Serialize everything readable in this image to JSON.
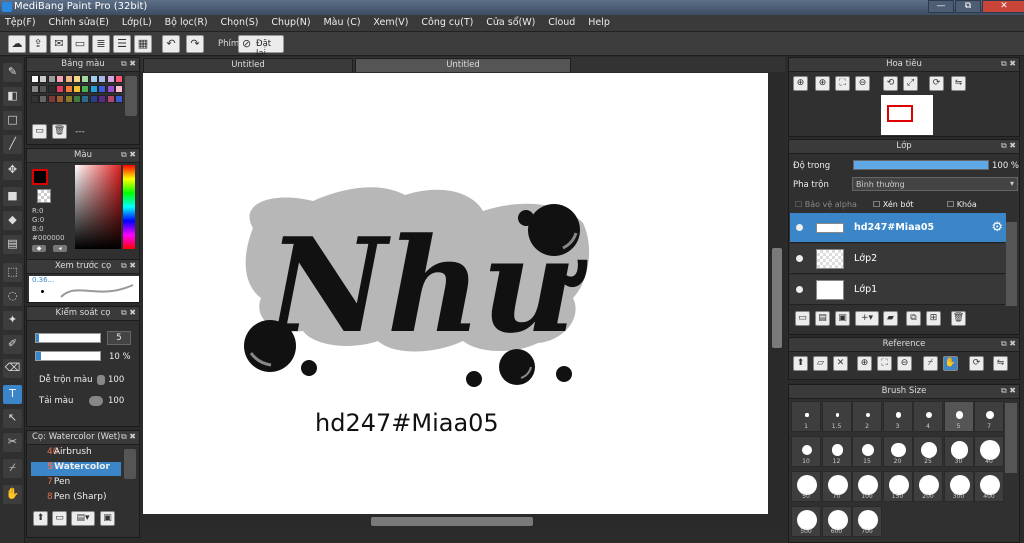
{
  "window": {
    "title": "MediBang Paint Pro (32bit)",
    "min": "—",
    "max": "⧉",
    "close": "✕"
  },
  "menu": [
    "Tệp(F)",
    "Chỉnh sửa(E)",
    "Lớp(L)",
    "Bộ lọc(R)",
    "Chọn(S)",
    "Chụp(N)",
    "Màu (C)",
    "Xem(V)",
    "Công cụ(T)",
    "Cửa sổ(W)",
    "Cloud",
    "Help"
  ],
  "toolbar": {
    "phim_label": "Phím",
    "reset_label": "Đặt lại"
  },
  "left_panels": {
    "palette": {
      "title": "Bảng màu",
      "dash": "---"
    },
    "color": {
      "title": "Màu",
      "r": "R:0",
      "g": "G:0",
      "b": "B:0",
      "hex": "#000000"
    },
    "brush_preview": {
      "title": "Xem trước cọ",
      "size": "0.36..."
    },
    "brush_control": {
      "title": "Kiểm soát cọ",
      "size_value": "5",
      "opacity_value": "10 %",
      "blend_label": "Dễ trộn màu",
      "blend_value": "100",
      "amount_label": "Tải màu",
      "amount_value": "100"
    },
    "brush_list": {
      "title": "Cọ: Watercolor (Wet)",
      "items": [
        {
          "num": "40",
          "name": "Airbrush"
        },
        {
          "num": "5",
          "name": "Watercolor"
        },
        {
          "num": "7",
          "name": "Pen"
        },
        {
          "num": "8",
          "name": "Pen (Sharp)"
        }
      ]
    }
  },
  "tabs": [
    "Untitled",
    "Untitled"
  ],
  "artwork": {
    "main_text": "Như",
    "caption": "hd247#Miaa05"
  },
  "right_panels": {
    "navigator": {
      "title": "Hoa tiêu"
    },
    "layer": {
      "title": "Lớp",
      "opacity_label": "Độ trong",
      "opacity_value": "100 %",
      "opacity_fraction": 1.0,
      "blend_label": "Pha trộn",
      "blend_value": "Bình thường",
      "alpha_label": "Bảo vệ alpha",
      "clip_label": "Xén bớt",
      "lock_label": "Khóa",
      "layers": [
        {
          "name": "hd247#Miaa05",
          "selected": true
        },
        {
          "name": "Lớp2",
          "selected": false
        },
        {
          "name": "Lớp1",
          "selected": false
        }
      ]
    },
    "reference": {
      "title": "Reference"
    },
    "brush_size": {
      "title": "Brush Size",
      "sizes": [
        "1",
        "1.5",
        "2",
        "3",
        "4",
        "5",
        "7",
        "10",
        "12",
        "15",
        "20",
        "25",
        "30",
        "40",
        "50",
        "70",
        "100",
        "150",
        "200",
        "300",
        "400",
        "500",
        "600",
        "700"
      ]
    }
  },
  "colors": {
    "accent": "#3a86c8",
    "panel_bg": "#303030",
    "canvas_bg": "#ffffff",
    "blob_gray": "#b7b7b7"
  }
}
